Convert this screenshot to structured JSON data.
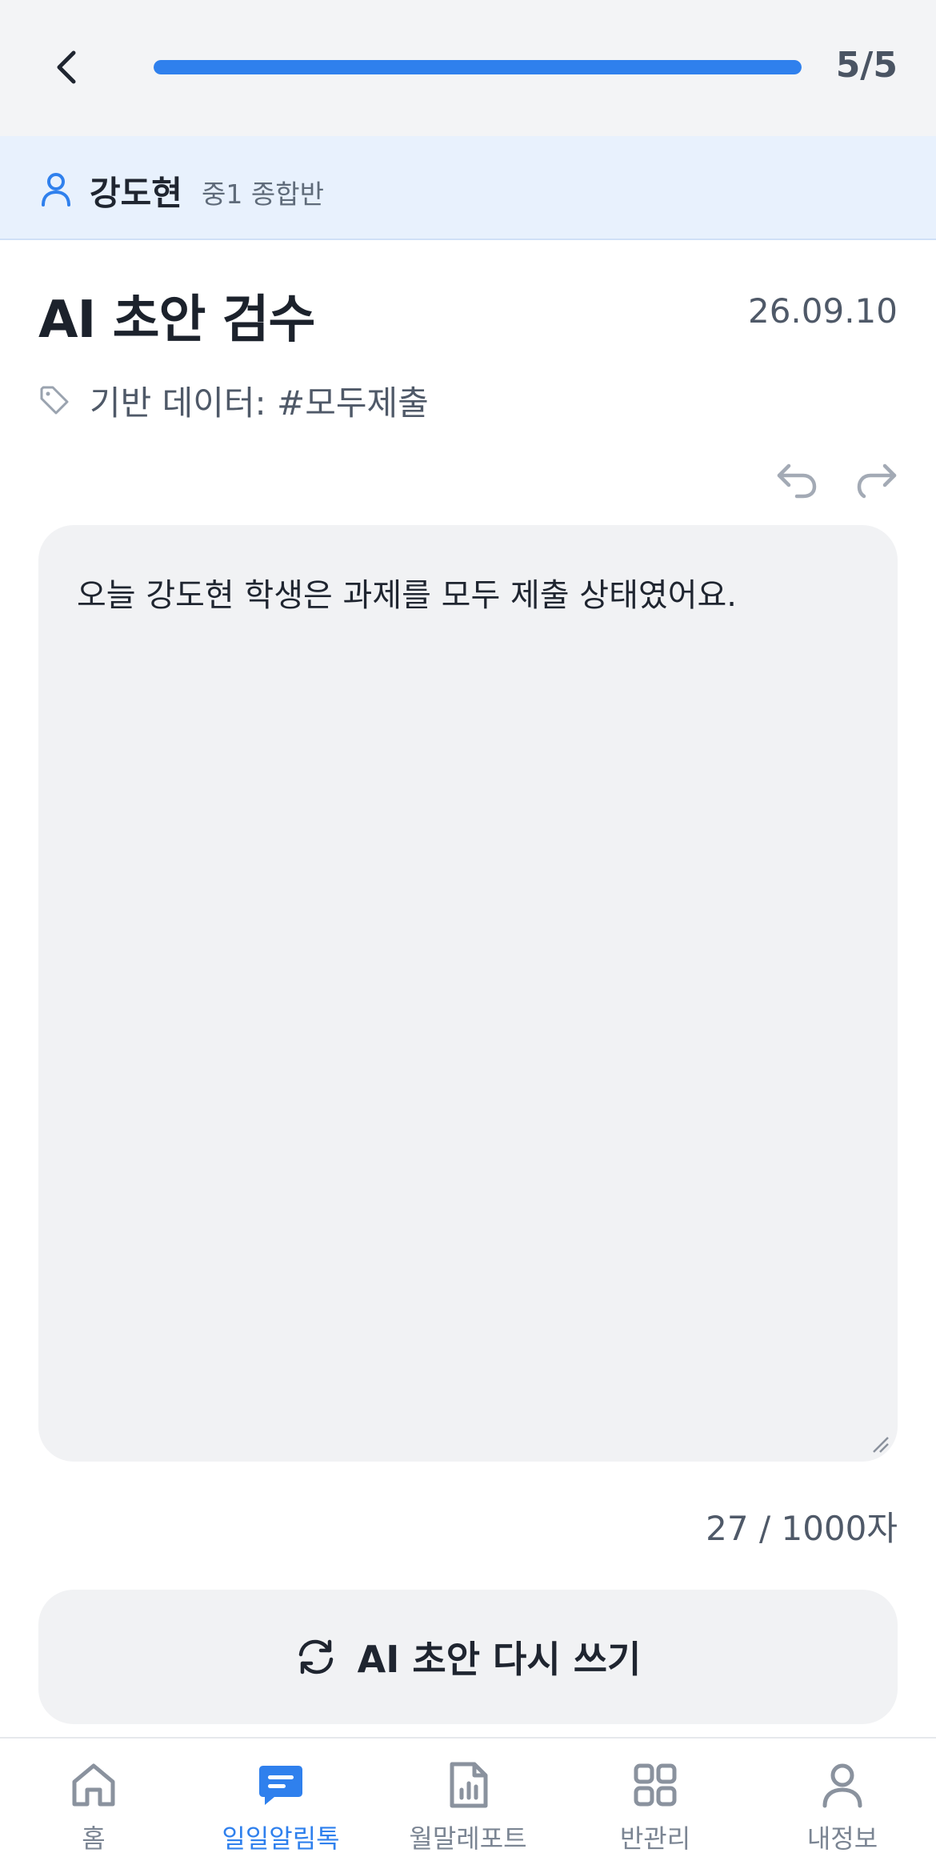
{
  "header": {
    "progress_text": "5/5",
    "progress_fraction": 1.0
  },
  "student": {
    "name": "강도현",
    "class": "중1 종합반"
  },
  "page": {
    "title": "AI 초안 검수",
    "date": "26.09.10",
    "tag": "기반 데이터: #모두제출"
  },
  "draft": {
    "text": "오늘 강도현 학생은 과제를 모두 제출 상태였어요.",
    "char_count": "27 / 1000자"
  },
  "actions": {
    "rewrite_label": "AI 초안 다시 쓰기"
  },
  "nav": {
    "items": [
      {
        "label": "홈",
        "icon": "home-icon",
        "active": false
      },
      {
        "label": "일일알림톡",
        "icon": "chat-icon",
        "active": true
      },
      {
        "label": "월말레포트",
        "icon": "report-icon",
        "active": false
      },
      {
        "label": "반관리",
        "icon": "grid-icon",
        "active": false
      },
      {
        "label": "내정보",
        "icon": "user-icon",
        "active": false
      }
    ]
  },
  "colors": {
    "accent": "#2f80ed",
    "student_bar_bg": "#e8f1fd",
    "surface": "#f1f2f4",
    "muted_text": "#4f5968"
  }
}
